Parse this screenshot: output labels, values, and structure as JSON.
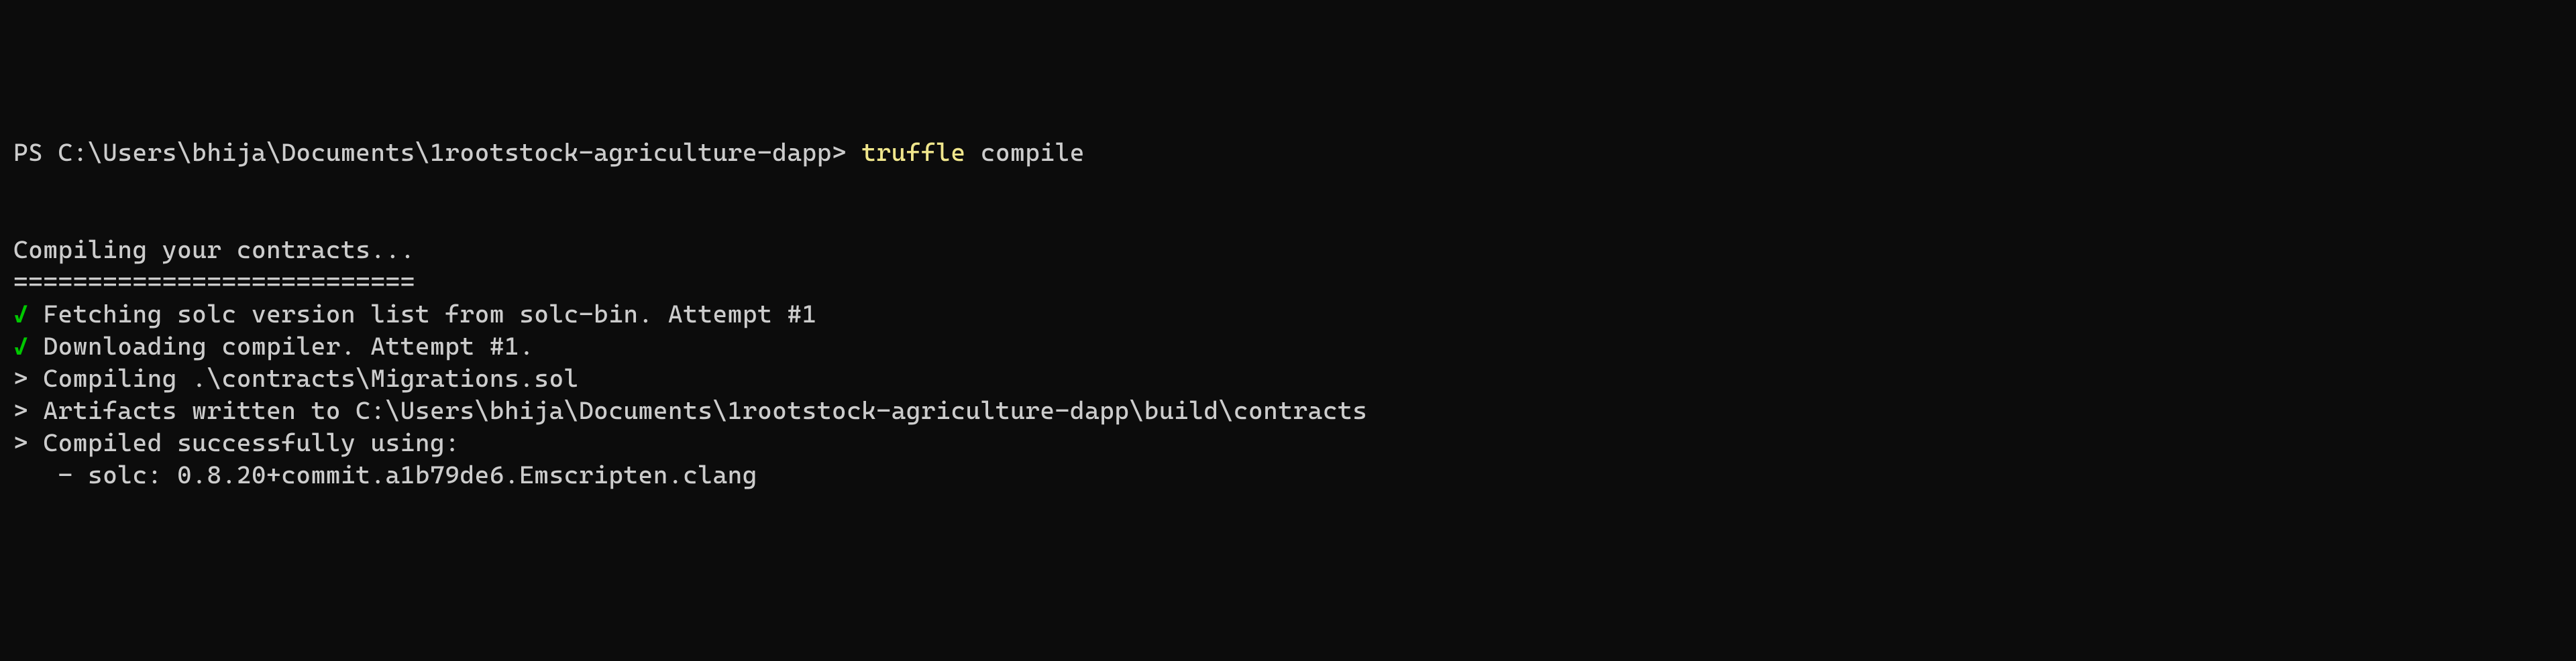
{
  "prompt": {
    "prefix": "PS ",
    "path": "C:\\Users\\bhija\\Documents\\1rootstock-agriculture-dapp",
    "suffix": "> ",
    "command": "truffle",
    "arg": " compile"
  },
  "output": {
    "header": "Compiling your contracts...",
    "separator": "===========================",
    "lines": [
      {
        "marker": "check",
        "text": " Fetching solc version list from solc-bin. Attempt #1"
      },
      {
        "marker": "check",
        "text": " Downloading compiler. Attempt #1."
      },
      {
        "marker": "gt",
        "text": " Compiling .\\contracts\\Migrations.sol"
      },
      {
        "marker": "gt",
        "text": " Artifacts written to C:\\Users\\bhija\\Documents\\1rootstock-agriculture-dapp\\build\\contracts"
      },
      {
        "marker": "gt",
        "text": " Compiled successfully using:"
      },
      {
        "marker": "none",
        "text": "   - solc: 0.8.20+commit.a1b79de6.Emscripten.clang"
      }
    ]
  },
  "markers": {
    "check": "✓",
    "gt": ">"
  }
}
